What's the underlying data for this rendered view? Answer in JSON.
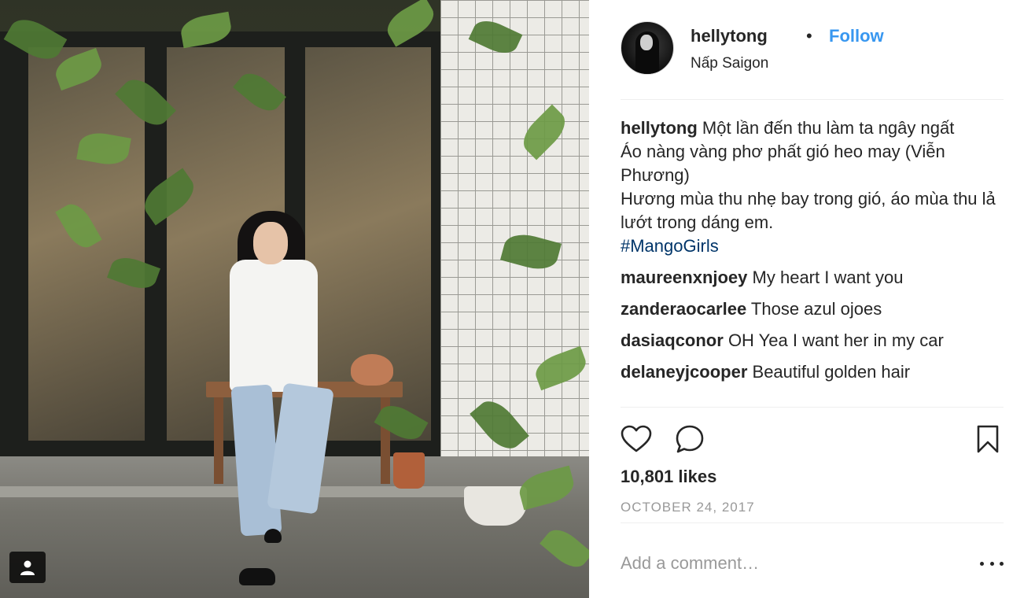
{
  "post": {
    "username": "hellytong",
    "separator": "•",
    "follow_label": "Follow",
    "location": "Nấp Saigon"
  },
  "caption": {
    "username": "hellytong",
    "lines": [
      "Một lần đến thu làm ta ngây ngất",
      "Áo nàng vàng phơ phất gió heo may (Viễn Phương)",
      "Hương mùa thu nhẹ bay trong gió, áo mùa thu lả lướt trong dáng em."
    ],
    "hashtag": "#MangoGirls"
  },
  "comments": [
    {
      "username": "maureenxnjoey",
      "text": "My heart I want you"
    },
    {
      "username": "zanderaocarlee",
      "text": "Those azul ojoes"
    },
    {
      "username": "dasiaqconor",
      "text": "OH Yea I want her in my car"
    },
    {
      "username": "delaneyjcooper",
      "text": "Beautiful golden hair"
    }
  ],
  "actions": {
    "like_icon": "heart-icon",
    "comment_icon": "comment-bubble-icon",
    "save_icon": "bookmark-icon"
  },
  "likes": "10,801 likes",
  "date": "OCTOBER 24, 2017",
  "add_comment": {
    "placeholder": "Add a comment…"
  },
  "more_icon": "more-options-icon",
  "photo_tag_icon": "user-tag-icon",
  "colors": {
    "follow": "#3897f0",
    "hashtag": "#003569",
    "text": "#262626",
    "muted": "#999999",
    "divider": "#efefef"
  }
}
